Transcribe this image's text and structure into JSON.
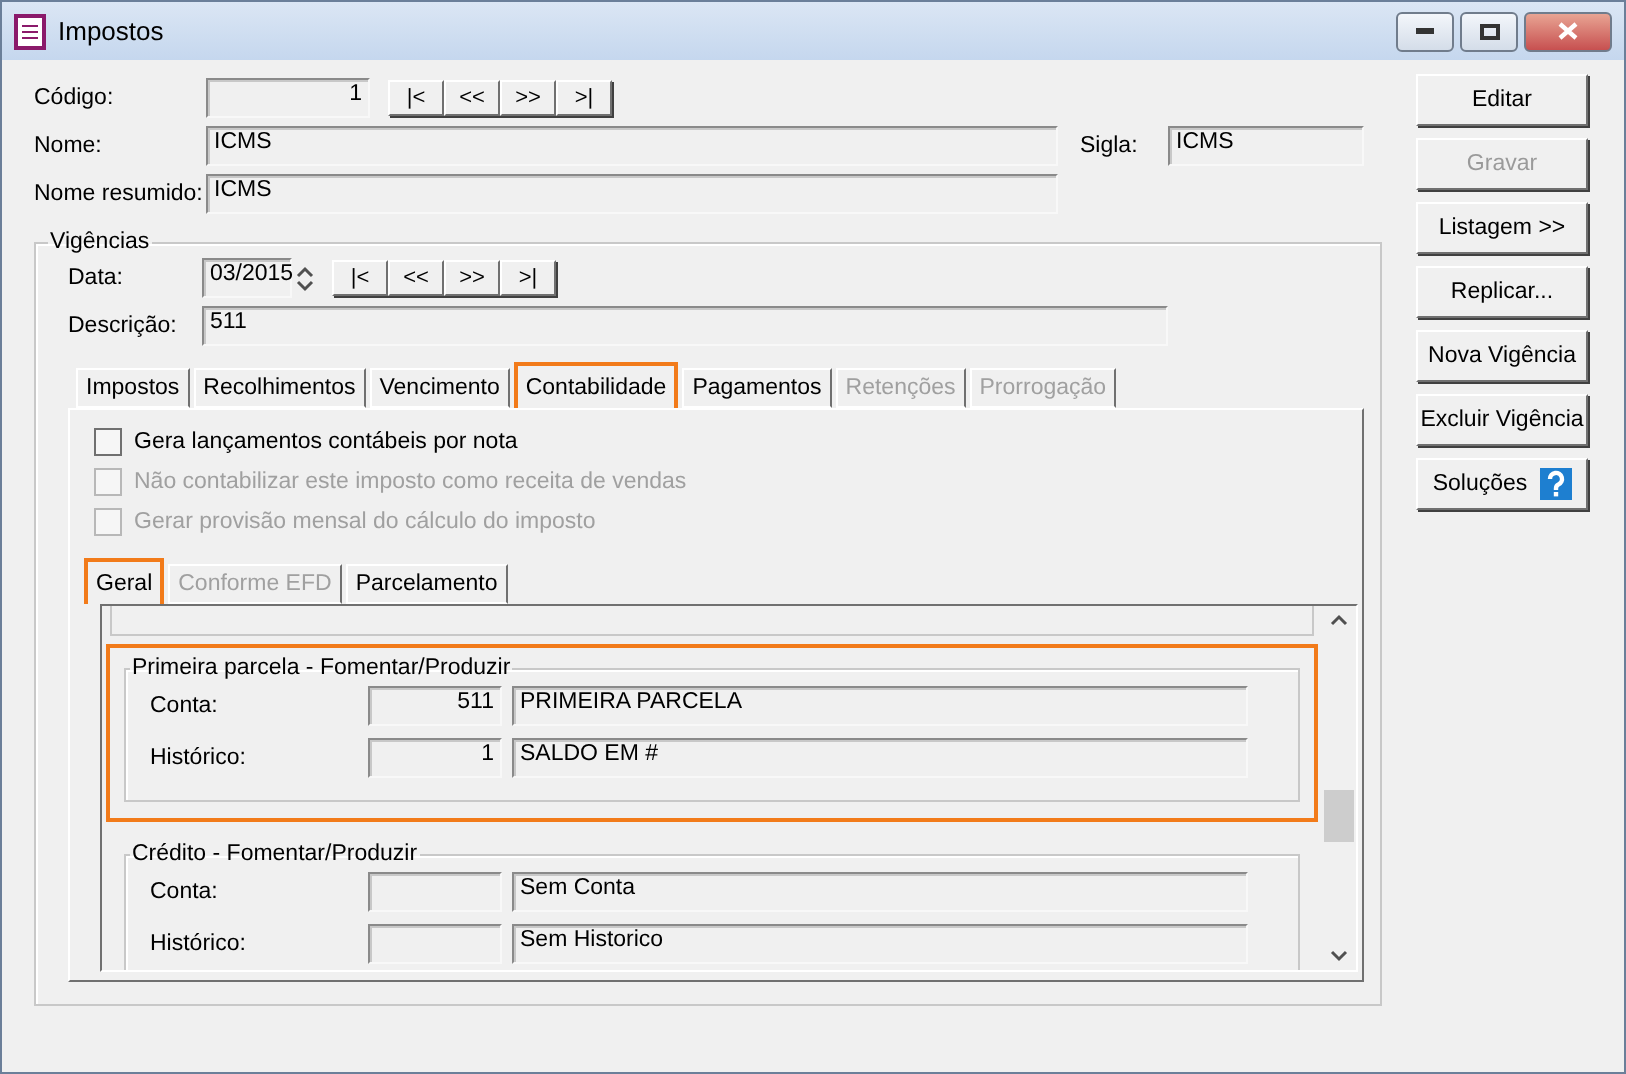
{
  "window": {
    "title": "Impostos"
  },
  "codigo": {
    "label": "Código:",
    "value": "1"
  },
  "record_nav": [
    "|<",
    "<<",
    ">>",
    ">|"
  ],
  "nome": {
    "label": "Nome:",
    "value": "ICMS"
  },
  "sigla": {
    "label": "Sigla:",
    "value": "ICMS"
  },
  "nome_resumido": {
    "label": "Nome resumido:",
    "value": "ICMS"
  },
  "vigencias": {
    "title": "Vigências",
    "data": {
      "label": "Data:",
      "value": "03/2015"
    },
    "nav": [
      "|<",
      "<<",
      ">>",
      ">|"
    ],
    "descricao": {
      "label": "Descrição:",
      "value": "511"
    },
    "tabs": [
      {
        "label": "Impostos",
        "selected": false,
        "disabled": false,
        "highlighted": false
      },
      {
        "label": "Recolhimentos",
        "selected": false,
        "disabled": false,
        "highlighted": false
      },
      {
        "label": "Vencimento",
        "selected": false,
        "disabled": false,
        "highlighted": false
      },
      {
        "label": "Contabilidade",
        "selected": true,
        "disabled": false,
        "highlighted": true
      },
      {
        "label": "Pagamentos",
        "selected": false,
        "disabled": false,
        "highlighted": false
      },
      {
        "label": "Retenções",
        "selected": false,
        "disabled": true,
        "highlighted": false
      },
      {
        "label": "Prorrogação",
        "selected": false,
        "disabled": true,
        "highlighted": false
      }
    ],
    "checkboxes": [
      {
        "label": "Gera lançamentos contábeis por nota",
        "checked": false,
        "disabled": false
      },
      {
        "label": "Não contabilizar este imposto como receita de vendas",
        "checked": false,
        "disabled": true
      },
      {
        "label": "Gerar provisão mensal do cálculo do imposto",
        "checked": false,
        "disabled": true
      }
    ],
    "subtabs": [
      {
        "label": "Geral",
        "selected": true,
        "disabled": false,
        "highlighted": true
      },
      {
        "label": "Conforme EFD",
        "selected": false,
        "disabled": true,
        "highlighted": false
      },
      {
        "label": "Parcelamento",
        "selected": false,
        "disabled": false,
        "highlighted": false
      }
    ],
    "sections": [
      {
        "title": "Primeira parcela - Fomentar/Produzir",
        "highlighted": true,
        "rows": [
          {
            "label": "Conta:",
            "code": "511",
            "description": "PRIMEIRA PARCELA"
          },
          {
            "label": "Histórico:",
            "code": "1",
            "description": "SALDO EM #"
          }
        ]
      },
      {
        "title": "Crédito - Fomentar/Produzir",
        "highlighted": false,
        "rows": [
          {
            "label": "Conta:",
            "code": "",
            "description": "Sem Conta"
          },
          {
            "label": "Histórico:",
            "code": "",
            "description": "Sem Historico"
          }
        ]
      }
    ]
  },
  "buttons": [
    {
      "label": "Editar",
      "disabled": false,
      "kind": "plain"
    },
    {
      "label": "Gravar",
      "disabled": true,
      "kind": "plain"
    },
    {
      "label": "Listagem >>",
      "disabled": false,
      "kind": "plain"
    },
    {
      "label": "Replicar...",
      "disabled": false,
      "kind": "plain"
    },
    {
      "label": "Nova Vigência",
      "disabled": false,
      "kind": "plain"
    },
    {
      "label": "Excluir Vigência",
      "disabled": false,
      "kind": "plain"
    },
    {
      "label": "Soluções",
      "disabled": false,
      "kind": "help"
    }
  ]
}
